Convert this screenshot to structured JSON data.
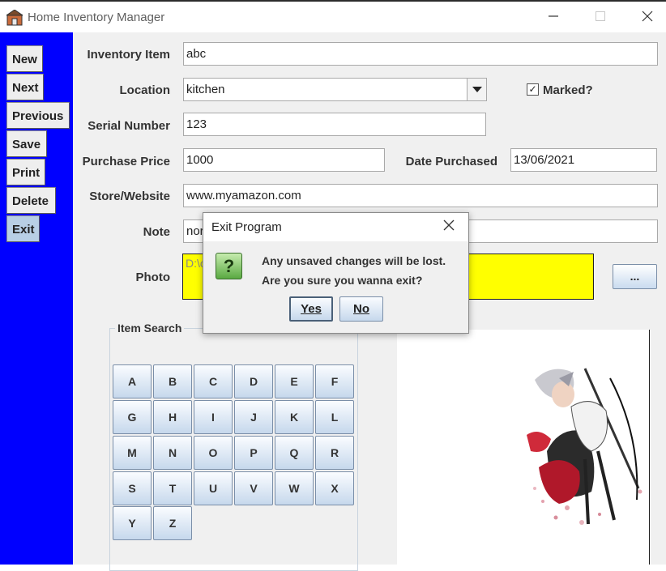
{
  "window": {
    "title": "Home Inventory Manager"
  },
  "sidebar": {
    "buttons": [
      {
        "label": "New"
      },
      {
        "label": "Next"
      },
      {
        "label": "Previous"
      },
      {
        "label": "Save"
      },
      {
        "label": "Print"
      },
      {
        "label": "Delete"
      },
      {
        "label": "Exit"
      }
    ]
  },
  "form": {
    "inventory_item": {
      "label": "Inventory Item",
      "value": "abc"
    },
    "location": {
      "label": "Location",
      "value": "kitchen"
    },
    "marked": {
      "label": "Marked?",
      "checked": true,
      "check_mark": "✓"
    },
    "serial_number": {
      "label": "Serial Number",
      "value": "123"
    },
    "purchase_price": {
      "label": "Purchase Price",
      "value": "1000"
    },
    "date_purchased": {
      "label": "Date Purchased",
      "value": "13/06/2021"
    },
    "store_website": {
      "label": "Store/Website",
      "value": "www.myamazon.com"
    },
    "note": {
      "label": "Note",
      "value": "nor"
    },
    "photo": {
      "label": "Photo",
      "value": "D:\\c",
      "browse_label": "..."
    }
  },
  "search": {
    "title": "Item Search",
    "letters": [
      "A",
      "B",
      "C",
      "D",
      "E",
      "F",
      "G",
      "H",
      "I",
      "J",
      "K",
      "L",
      "M",
      "N",
      "O",
      "P",
      "Q",
      "R",
      "S",
      "T",
      "U",
      "V",
      "W",
      "X",
      "Y",
      "Z"
    ]
  },
  "dialog": {
    "title": "Exit Program",
    "message_line1": "Any unsaved changes will be lost.",
    "message_line2": "Are you sure you wanna exit?",
    "yes_label": "Yes",
    "no_label": "No",
    "icon_glyph": "?"
  },
  "colors": {
    "sidebar": "#0000ff",
    "photo_field": "#ffff00",
    "active_button": "#b8cfe5",
    "question_icon": "#5aa942"
  }
}
